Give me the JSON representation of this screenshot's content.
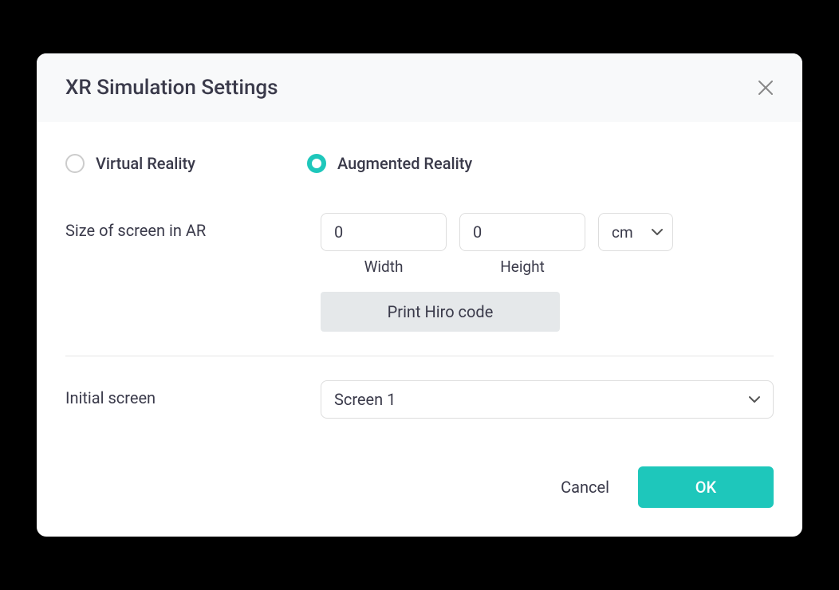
{
  "dialog": {
    "title": "XR Simulation Settings"
  },
  "mode": {
    "options": [
      {
        "label": "Virtual Reality",
        "selected": false
      },
      {
        "label": "Augmented Reality",
        "selected": true
      }
    ]
  },
  "size": {
    "label": "Size of screen in AR",
    "width_value": "0",
    "width_label": "Width",
    "height_value": "0",
    "height_label": "Height",
    "unit": "cm",
    "print_button": "Print Hiro code"
  },
  "initial": {
    "label": "Initial screen",
    "value": "Screen 1"
  },
  "footer": {
    "cancel": "Cancel",
    "ok": "OK"
  }
}
